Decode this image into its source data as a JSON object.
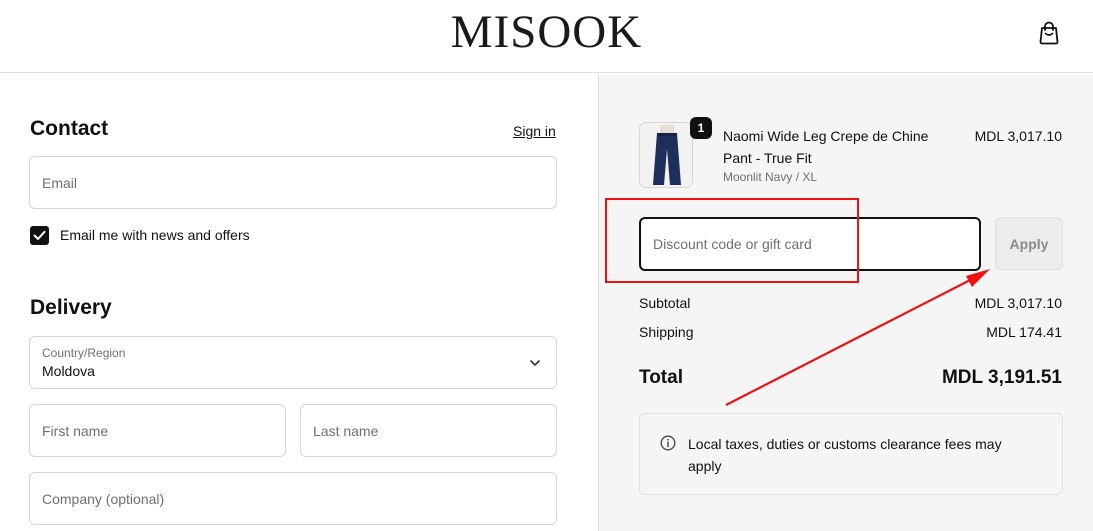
{
  "header": {
    "logo": "MISOOK",
    "cart_icon": "shopping-bag-icon"
  },
  "contact": {
    "title": "Contact",
    "sign_in_label": "Sign in",
    "email_placeholder": "Email",
    "newsletter_label": "Email me with news and offers",
    "newsletter_checked": true
  },
  "delivery": {
    "title": "Delivery",
    "country_label": "Country/Region",
    "country_value": "Moldova",
    "first_name_placeholder": "First name",
    "last_name_placeholder": "Last name",
    "company_placeholder": "Company (optional)"
  },
  "order": {
    "product": {
      "name": "Naomi Wide Leg Crepe de Chine Pant - True Fit",
      "variant": "Moonlit Navy / XL",
      "price": "MDL 3,017.10",
      "quantity": "1"
    },
    "discount_placeholder": "Discount code or gift card",
    "apply_label": "Apply",
    "subtotal_label": "Subtotal",
    "subtotal_value": "MDL 3,017.10",
    "shipping_label": "Shipping",
    "shipping_value": "MDL 174.41",
    "total_label": "Total",
    "total_value": "MDL 3,191.51",
    "notice": "Local taxes, duties or customs clearance fees may apply"
  },
  "annotation": {
    "color": "#ee1111"
  }
}
